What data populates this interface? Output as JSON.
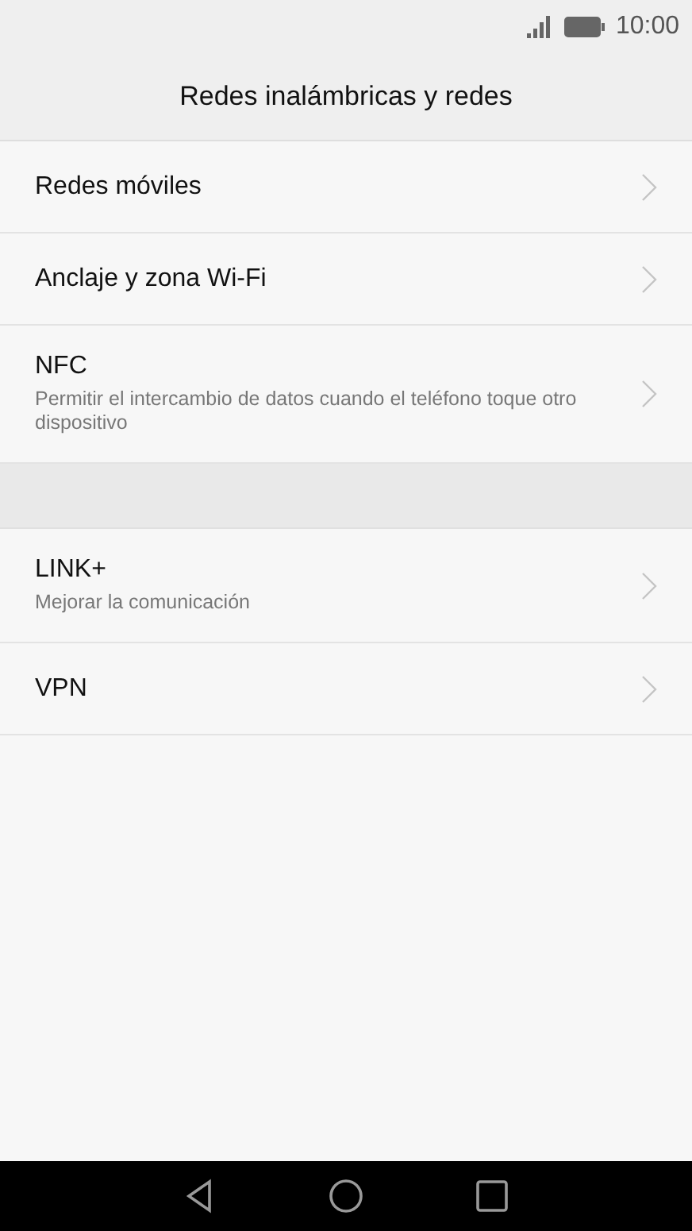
{
  "status_bar": {
    "time": "10:00"
  },
  "title": "Redes inalámbricas y redes",
  "sections": [
    {
      "items": [
        {
          "label": "Redes móviles"
        },
        {
          "label": "Anclaje y zona Wi-Fi"
        },
        {
          "label": "NFC",
          "summary": "Permitir el intercambio de datos cuando el teléfono toque otro dispositivo"
        }
      ]
    },
    {
      "items": [
        {
          "label": "LINK+",
          "summary": "Mejorar la comunicación"
        },
        {
          "label": "VPN"
        }
      ]
    }
  ]
}
